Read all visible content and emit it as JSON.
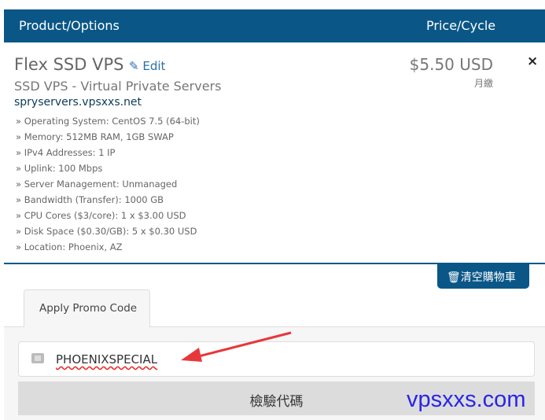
{
  "header": {
    "product_col": "Product/Options",
    "price_col": "Price/Cycle"
  },
  "item": {
    "name": "Flex SSD VPS",
    "edit_label": "Edit",
    "group": "SSD VPS - Virtual Private Servers",
    "domain": "spryservers.vpsxxs.net",
    "options": [
      "» Operating System: CentOS 7.5 (64-bit)",
      "» Memory: 512MB RAM, 1GB SWAP",
      "» IPv4 Addresses: 1 IP",
      "» Uplink: 100 Mbps",
      "» Server Management: Unmanaged",
      "» Bandwidth (Transfer): 1000 GB",
      "» CPU Cores ($3/core): 1 x $3.00 USD",
      "» Disk Space ($0.30/GB): 5 x $0.30 USD",
      "» Location: Phoenix, AZ"
    ],
    "price": "$5.50 USD",
    "cycle": "月繳",
    "remove": "×"
  },
  "empty_cart_label": "清空購物車",
  "promo": {
    "tab": "Apply Promo Code",
    "code": "PHOENIXSPECIAL",
    "validate_label": "檢驗代碼"
  },
  "watermark": "vpsxxs.com",
  "colors": {
    "primary": "#0a5787",
    "arrow": "#e8373a",
    "watermark": "#2a24e8"
  }
}
